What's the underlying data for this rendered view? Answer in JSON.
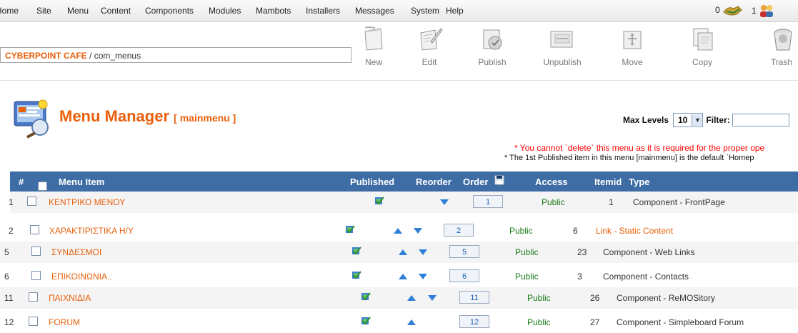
{
  "menubar": {
    "items": [
      "Home",
      "Site",
      "Menu",
      "Content",
      "Components",
      "Modules",
      "Mambots",
      "Installers",
      "Messages",
      "System",
      "Help"
    ],
    "messages_count": "0",
    "users_count": "1"
  },
  "pathway": {
    "site": "CYBERPOINT CAFE",
    "separator": " / ",
    "component": "com_menus"
  },
  "toolbar": {
    "buttons": [
      {
        "label": "New",
        "icon": "new-icon"
      },
      {
        "label": "Edit",
        "icon": "edit-icon"
      },
      {
        "label": "Publish",
        "icon": "publish-icon"
      },
      {
        "label": "Unpublish",
        "icon": "unpublish-icon"
      },
      {
        "label": "Move",
        "icon": "move-icon"
      },
      {
        "label": "Copy",
        "icon": "copy-icon"
      },
      {
        "label": "Trash",
        "icon": "trash-icon"
      }
    ]
  },
  "header": {
    "title": "Menu Manager",
    "subtitle": "[ mainmenu ]",
    "max_levels_label": "Max Levels",
    "max_levels_value": "10",
    "filter_label": "Filter:",
    "warning": "* You cannot `delete` this menu as it is required for the proper ope",
    "note": "* The 1st Published item in this menu [mainmenu] is the default `Homep"
  },
  "table": {
    "columns": {
      "num": "#",
      "item": "Menu Item",
      "published": "Published",
      "reorder": "Reorder",
      "order": "Order",
      "access": "Access",
      "itemid": "Itemid",
      "type": "Type"
    },
    "rows": [
      {
        "num": "1",
        "name": "ΚΕΝΤΡΙΚΟ ΜΕΝΟΥ",
        "order": "1",
        "access": "Public",
        "itemid": "1",
        "type": "Component - FrontPage",
        "type_is_link": false,
        "up": false,
        "down": true
      },
      {
        "num": "2",
        "name": "ΧΑΡΑΚΤΙΡΙΣΤΙΚΑ Η/Υ",
        "order": "2",
        "access": "Public",
        "itemid": "6",
        "type": "Link - Static Content",
        "type_is_link": true,
        "up": true,
        "down": true
      },
      {
        "num": "5",
        "name": "ΣΥΝΔΕΣΜΟΙ",
        "order": "5",
        "access": "Public",
        "itemid": "23",
        "type": "Component - Web Links",
        "type_is_link": false,
        "up": true,
        "down": true
      },
      {
        "num": "6",
        "name": "ΕΠΙΚΟΙΝΩΝΙΑ..",
        "order": "6",
        "access": "Public",
        "itemid": "3",
        "type": "Component - Contacts",
        "type_is_link": false,
        "up": true,
        "down": true
      },
      {
        "num": "11",
        "name": "ΠΑΙΧΝΙΔΙΑ",
        "order": "11",
        "access": "Public",
        "itemid": "26",
        "type": "Component - ReMOSitory",
        "type_is_link": false,
        "up": true,
        "down": true
      },
      {
        "num": "12",
        "name": "FORUM",
        "order": "12",
        "access": "Public",
        "itemid": "27",
        "type": "Component - Simpleboard Forum",
        "type_is_link": false,
        "up": true,
        "down": false
      }
    ]
  },
  "colors": {
    "accent": "#e8600c",
    "header_bg": "#3e6da5",
    "access": "#1a7a1a",
    "warning": "#ff0000"
  }
}
